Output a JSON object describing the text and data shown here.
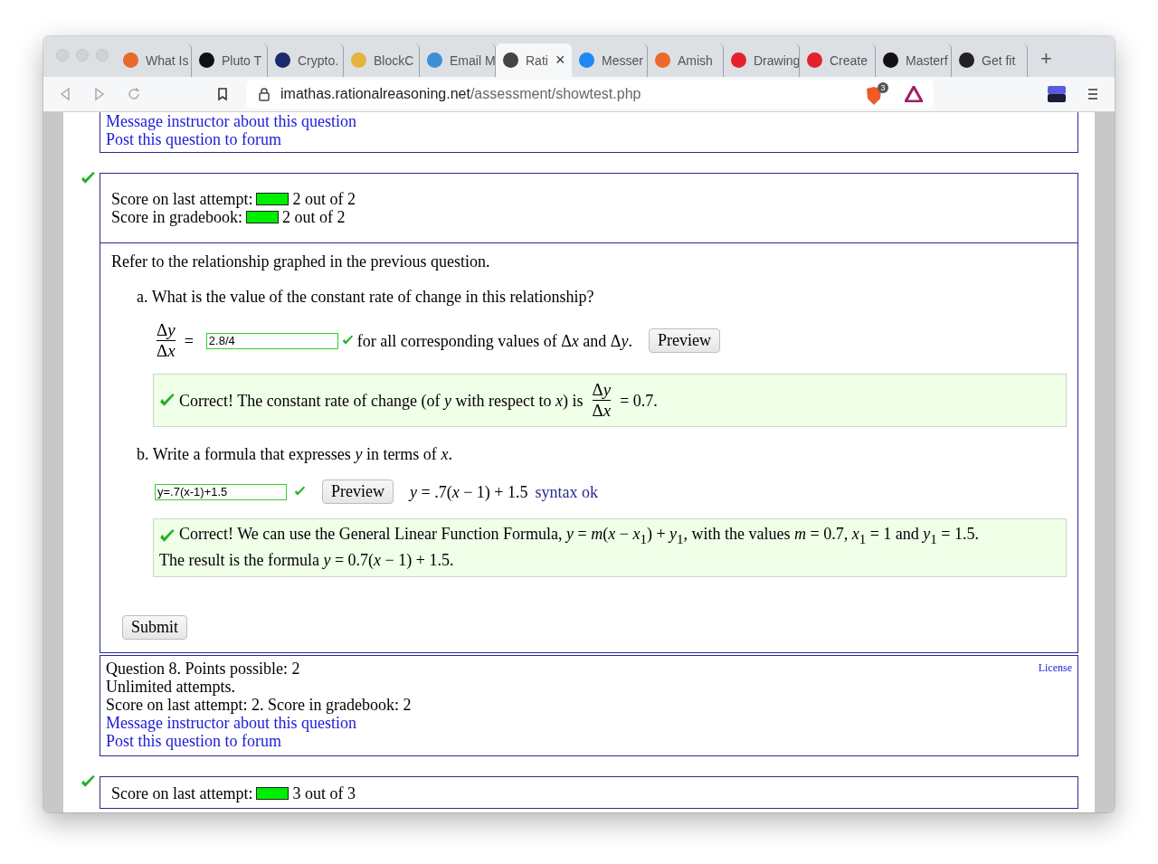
{
  "browser": {
    "tabs": [
      {
        "label": "What Is",
        "color": "#e8692c",
        "selected": false
      },
      {
        "label": "Pluto T",
        "color": "#111111",
        "selected": false
      },
      {
        "label": "Crypto.",
        "color": "#1a2a6c",
        "selected": false
      },
      {
        "label": "BlockC",
        "color": "#e5b33d",
        "selected": false
      },
      {
        "label": "Email M",
        "color": "#3d8fd6",
        "selected": false
      },
      {
        "label": "Rati",
        "color": "#444444",
        "selected": true
      },
      {
        "label": "Messer",
        "color": "#1e88f0",
        "selected": false
      },
      {
        "label": "Amish",
        "color": "#ee6a2a",
        "selected": false
      },
      {
        "label": "Drawing",
        "color": "#e3222c",
        "selected": false
      },
      {
        "label": "Create",
        "color": "#e3222c",
        "selected": false
      },
      {
        "label": "Masterf",
        "color": "#111111",
        "selected": false
      },
      {
        "label": "Get fit",
        "color": "#222222",
        "selected": false
      }
    ],
    "new_tab": "+",
    "close_tab": "×",
    "url_host": "imathas.rationalreasoning.net",
    "url_path": "/assessment/showtest.php",
    "shield_count": "3"
  },
  "top_links": [
    "Message instructor about this question",
    "Post this question to forum"
  ],
  "question": {
    "scores": [
      {
        "label": "Score on last attempt:",
        "level": 1,
        "value": "2 out of 2"
      },
      {
        "label": "Score in gradebook:",
        "level": 1,
        "value": "2 out of 2"
      }
    ],
    "intro": "Refer to the relationship graphed in the previous question.",
    "part_a": {
      "prompt": "a. What is the value of the constant rate of change in this relationship?",
      "num": [
        "Δ",
        "y"
      ],
      "den": [
        "Δ",
        "x"
      ],
      "equals": "=",
      "answer": "2.8/4",
      "correct": true,
      "after": [
        "for all corresponding values of Δ",
        "x",
        " and Δ",
        "y",
        "."
      ],
      "preview": "Preview",
      "feedback_before": "Correct! The constant rate of change (of *y* with respect to *x*) is",
      "feedback_num": [
        "Δ",
        "y"
      ],
      "feedback_den": [
        "Δ",
        "x"
      ],
      "feedback_after": "= 0.7."
    },
    "part_b": {
      "prompt": "b. Write a formula that expresses *y* in terms of *x*.",
      "answer": "y=.7(x-1)+1.5",
      "correct": true,
      "preview": "Preview",
      "rendered": "*y* = .7(*x* − 1) + 1.5",
      "syntax": "syntax ok",
      "feedback": [
        "Correct! We can use the General Linear Function Formula, *y* = *m*(*x* − *x*$_{1}$) + *y*$_{1}$, with the values *m* = 0.7, *x*$_{1}$ = 1 and *y*$_{1}$ = 1.5.",
        "The result is the formula *y* = 0.7(*x* − 1) + 1.5."
      ]
    },
    "submit": "Submit"
  },
  "info": {
    "lines": [
      "Question 8. Points possible: 2",
      "Unlimited attempts.",
      "Score on last attempt: 2. Score in gradebook: 2"
    ],
    "links": [
      "Message instructor about this question",
      "Post this question to forum"
    ],
    "license": "License"
  },
  "next_score": {
    "label": "Score on last attempt:",
    "level": 1,
    "value": "3 out of 3"
  }
}
